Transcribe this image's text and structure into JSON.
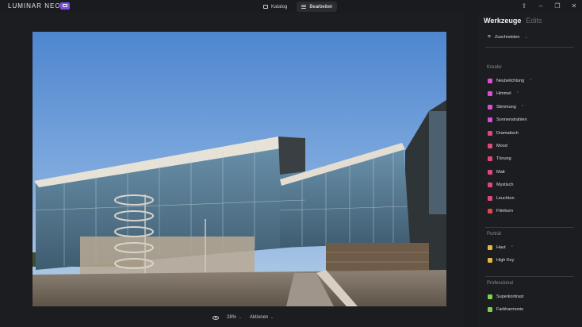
{
  "app": {
    "logo_text": "LUMINAR NEO"
  },
  "center_tabs": [
    {
      "label": "Katalog",
      "icon": "folder-icon"
    },
    {
      "label": "Bearbeiten",
      "icon": "sliders-icon"
    }
  ],
  "window_controls": [
    "share-icon",
    "minimize-icon",
    "restore-icon",
    "close-icon"
  ],
  "panel": {
    "tabs": [
      {
        "label": "Werkzeuge",
        "active": true
      },
      {
        "label": "Edits",
        "active": false
      }
    ],
    "crop": {
      "label": "Zuschneiden"
    },
    "sections": [
      {
        "title": "Kreativ",
        "tools": [
          {
            "label": "Neubelichtung",
            "icon": "relight-icon",
            "color": "#d94fd1",
            "submenu": true
          },
          {
            "label": "Himmel",
            "icon": "sky-icon",
            "color": "#d94fd1",
            "submenu": true
          },
          {
            "label": "Stimmung",
            "icon": "atmosphere-icon",
            "color": "#d94fd1",
            "submenu": true
          },
          {
            "label": "Sonnenstrahlen",
            "icon": "sunrays-icon",
            "color": "#d94fd1",
            "submenu": false
          },
          {
            "label": "Dramatisch",
            "icon": "dramatic-icon",
            "color": "#e0477a",
            "submenu": false
          },
          {
            "label": "Mood",
            "icon": "mood-icon",
            "color": "#e0477a",
            "submenu": false
          },
          {
            "label": "Tönung",
            "icon": "toning-icon",
            "color": "#e0477a",
            "submenu": false
          },
          {
            "label": "Matt",
            "icon": "matte-icon",
            "color": "#e0477a",
            "submenu": false
          },
          {
            "label": "Mystisch",
            "icon": "mystical-icon",
            "color": "#e0477a",
            "submenu": false
          },
          {
            "label": "Leuchten",
            "icon": "glow-icon",
            "color": "#e0477a",
            "submenu": false
          },
          {
            "label": "Filmkorn",
            "icon": "grain-icon",
            "color": "#e04747",
            "submenu": false
          }
        ]
      },
      {
        "title": "Porträt",
        "tools": [
          {
            "label": "Haut",
            "icon": "skin-icon",
            "color": "#e8b547",
            "submenu": true
          },
          {
            "label": "High Key",
            "icon": "highkey-icon",
            "color": "#e8b547",
            "submenu": false
          }
        ]
      },
      {
        "title": "Professional",
        "tools": [
          {
            "label": "Superkontrast",
            "icon": "supercontrast-icon",
            "color": "#7bd34f",
            "submenu": false
          },
          {
            "label": "Farbharmonie",
            "icon": "color-harmony-icon",
            "color": "#7bd34f",
            "submenu": false
          }
        ]
      }
    ]
  },
  "bottom": {
    "zoom": "28%",
    "actions_label": "Aktionen"
  }
}
